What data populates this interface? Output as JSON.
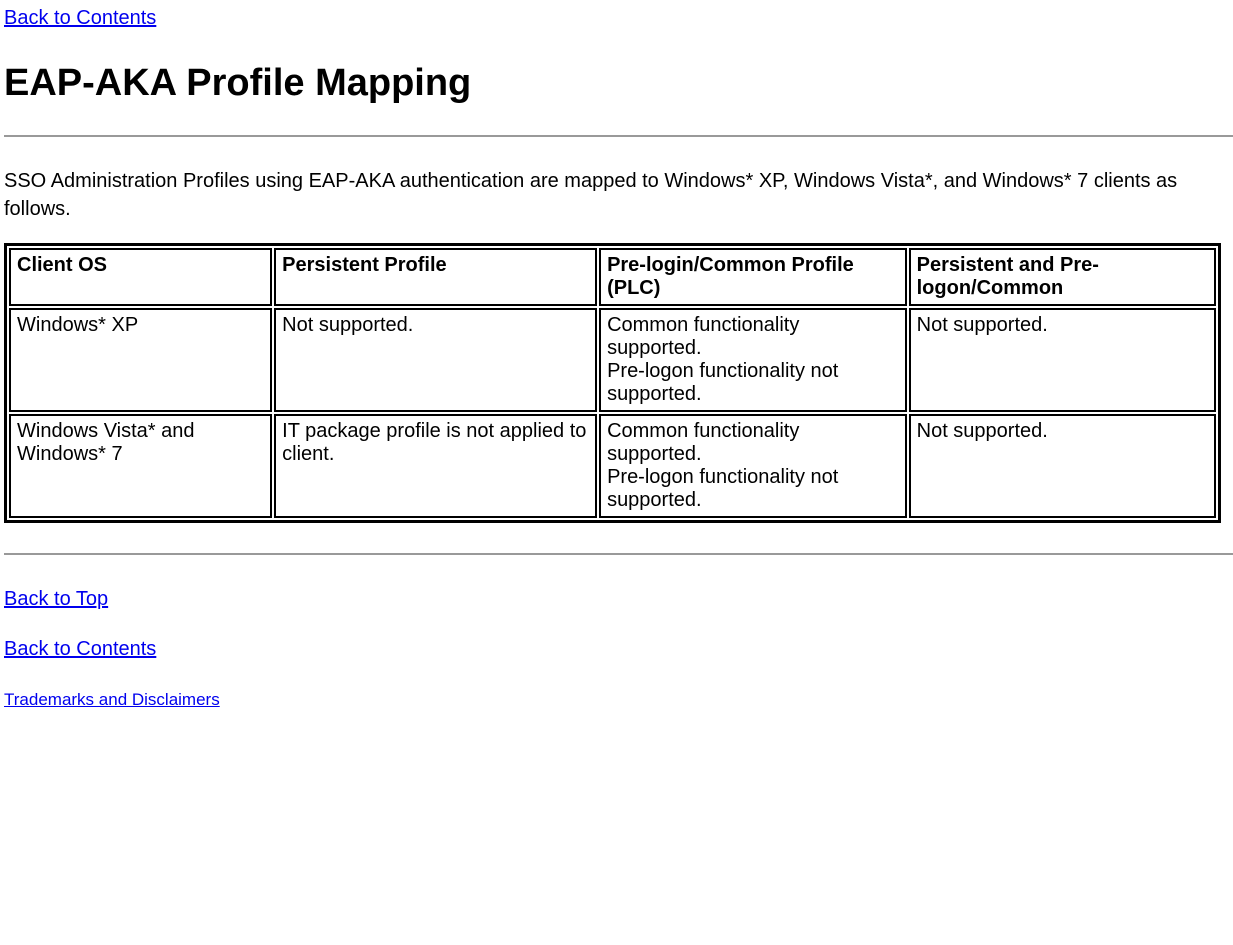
{
  "links": {
    "back_to_contents": "Back to Contents",
    "back_to_top": "Back to Top",
    "trademarks": "Trademarks and Disclaimers"
  },
  "heading": "EAP-AKA Profile Mapping",
  "intro": "SSO Administration Profiles using EAP-AKA authentication are mapped to Windows* XP, Windows Vista*, and Windows* 7 clients as follows.",
  "table": {
    "headers": {
      "col0": "Client OS",
      "col1": "Persistent Profile",
      "col2": "Pre-login/Common Profile (PLC)",
      "col3": "Persistent and Pre-logon/Common"
    },
    "rows": [
      {
        "col0": "Windows* XP",
        "col1": "Not supported.",
        "col2_a": "Common functionality supported.",
        "col2_b": "Pre-logon functionality not supported.",
        "col3": "Not supported."
      },
      {
        "col0": "Windows Vista* and Windows* 7",
        "col1": "IT package profile is not applied to client.",
        "col2_a": "Common functionality supported.",
        "col2_b": "Pre-logon functionality not supported.",
        "col3": "Not supported."
      }
    ]
  }
}
